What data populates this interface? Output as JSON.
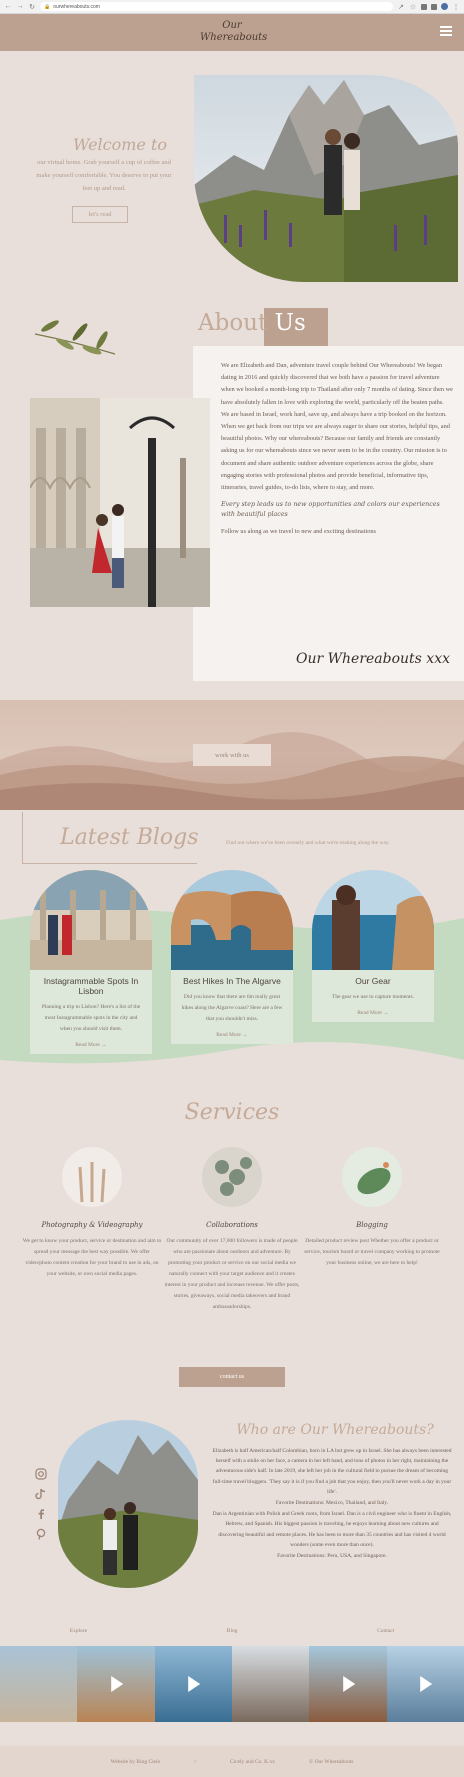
{
  "browser": {
    "url": "ourwhereabouts.com"
  },
  "header": {
    "logo_line1": "Our",
    "logo_line2": "Whereabouts"
  },
  "welcome": {
    "title": "Welcome to",
    "text": "our virtual home. Grab yourself a cup of coffee and make yourself comfortable. You deserve to put your feet up and read.",
    "button": "let's read"
  },
  "about": {
    "title_a": "About",
    "title_b": "Us",
    "p1": "We are Elizabeth and Dan, adventure travel couple behind Our Whereabouts! We began dating in 2016 and quickly discovered that we both have a passion for travel adventure when we booked a month-long trip to Thailand after only 7 months of dating. Since then we have absolutely fallen in love with exploring the world, particularly off the beaten paths. We are based in Israel, work hard, save up, and always have a trip booked on the horizon. When we get back from our trips we are always eager to share our stories, helpful tips, and beautiful photos. Why our whereabouts? Because our family and friends are constantly asking us for our whereabouts since we never seem to be in the country. Our mission is to document and share authentic outdoor adventure experiences across the globe, share engaging stories with professional photos and provide beneficial, informative tips, itineraries, travel guides, to-do lists, where to stay, and more.",
    "script": "Every step leads us to new opportunities and colors our experiences with beautiful places",
    "follow": "Follow us along as we travel to new and exciting destinations",
    "signature": "Our Whereabouts xxx"
  },
  "banner": {
    "button": "work with us"
  },
  "blogs": {
    "title": "Latest Blogs",
    "subtitle": "Find out where we've been recently and what we're making along the way.",
    "posts": [
      {
        "title": "Instagrammable Spots In Lisbon",
        "excerpt": "Planning a trip to Lisbon? Here's a list of the most Instagrammable spots in the city and when you should visit them.",
        "more": "Read More →"
      },
      {
        "title": "Best Hikes In The Algarve",
        "excerpt": "Did you know that there are 6m really great hikes along the Algarve coast? Here are a few that you shouldn't miss.",
        "more": "Read More →"
      },
      {
        "title": "Our Gear",
        "excerpt": "The gear we use to capture moments.",
        "more": "Read More →"
      }
    ]
  },
  "services": {
    "title": "Services",
    "items": [
      {
        "name": "Photography & Videography",
        "desc": "We get to know your product, service or destination and aim to spread your message the best way possible. We offer video/photo content creation for your brand to use in ads, on your website, or own social media pages."
      },
      {
        "name": "Collaborations",
        "desc": "Our community of over 17,000 followers is made of people who are passionate about outdoors and adventure. By promoting your product or service on our social media we naturally connect with your target audience and it creates interest in your product and increase revenue. We offer posts, stories, giveaways, social media takeovers and brand ambassadorships."
      },
      {
        "name": "Blogging",
        "desc": "Detailed product review post Whether you offer a product or service, tourism board or travel company working to promote your business online, we are here to help!"
      }
    ],
    "button": "contact us"
  },
  "who": {
    "title": "Who are Our Whereabouts?",
    "p1": "Elizabeth is half American/half Colombian, born in LA but grew up in Israel. She has always been interested herself with a smile on her face, a camera in her left hand, and tons of photos in her right, maintaining the adventurous side's half. In late 2019, she left her job in the cultural field to pursue the dream of becoming full-time travel bloggers. 'They say it is if you find a job that you enjoy, then you'll never work a day in your life'.",
    "p2": "Favorite Destinations: Mexico, Thailand, and Italy.",
    "p3": "Dan is Argentinian with Polish and Greek roots, from Israel. Dan is a civil engineer who is fluent in English, Hebrew, and Spanish. His biggest passion is traveling, he enjoys learning about new cultures and discovering beautiful and remote places. He has been to more than 35 countries and has visited 4 world wonders (some even more than once).",
    "p4": "Favorite Destinations: Peru, USA, and Singapore."
  },
  "footer": {
    "links": [
      "Explore",
      "Blog",
      "Contact"
    ],
    "bottom": [
      "Website by Bing Cielo",
      "/",
      "Cicely and Co. K.xx",
      "© Our Whereabouts"
    ]
  }
}
